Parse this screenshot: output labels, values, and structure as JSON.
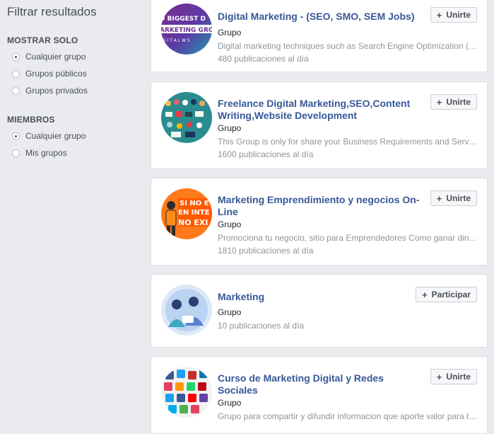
{
  "sidebar": {
    "title": "Filtrar resultados",
    "show_only": {
      "label": "MOSTRAR SOLO",
      "options": [
        {
          "label": "Cualquier grupo",
          "checked": true
        },
        {
          "label": "Grupos públicos",
          "checked": false
        },
        {
          "label": "Grupos privados",
          "checked": false
        }
      ]
    },
    "members": {
      "label": "MIEMBROS",
      "options": [
        {
          "label": "Cualquier grupo",
          "checked": true
        },
        {
          "label": "Mis grupos",
          "checked": false
        }
      ]
    }
  },
  "groups": [
    {
      "title": "Digital Marketing - (SEO, SMO, SEM Jobs)",
      "type": "Grupo",
      "description": "Digital marketing techniques such as Search Engine Optimization (SEO), Search Engine Marketing (SEM)",
      "activity": "480 publicaciones al día",
      "button": "Unirte",
      "thumb_text": [
        "D BIGGEST D",
        "ARKETING GRO",
        "G I T A L  W S"
      ]
    },
    {
      "title": "Freelance Digital Marketing,SEO,Content Writing,Website Development",
      "type": "Grupo",
      "description": "This Group is only for share your Business Requirements and Services",
      "activity": "1600 publicaciones al día",
      "button": "Unirte"
    },
    {
      "title": "Marketing Emprendimiento y negocios On-Line",
      "type": "Grupo",
      "description": "Promociona tu negocio, sitio para Emprendedores Como ganar dinero",
      "activity": "1810 publicaciones al día",
      "button": "Unirte",
      "thumb_text": [
        "SI NO E",
        "EN INTE",
        "NO EXI"
      ]
    },
    {
      "title": "Marketing",
      "type": "Grupo",
      "description": "",
      "activity": "10 publicaciones al día",
      "button": "Participar"
    },
    {
      "title": "Curso de Marketing Digital y Redes Sociales",
      "type": "Grupo",
      "description": "Grupo para compartir y difundir informacion que aporte valor para todos",
      "activity": "",
      "button": "Unirte"
    }
  ]
}
